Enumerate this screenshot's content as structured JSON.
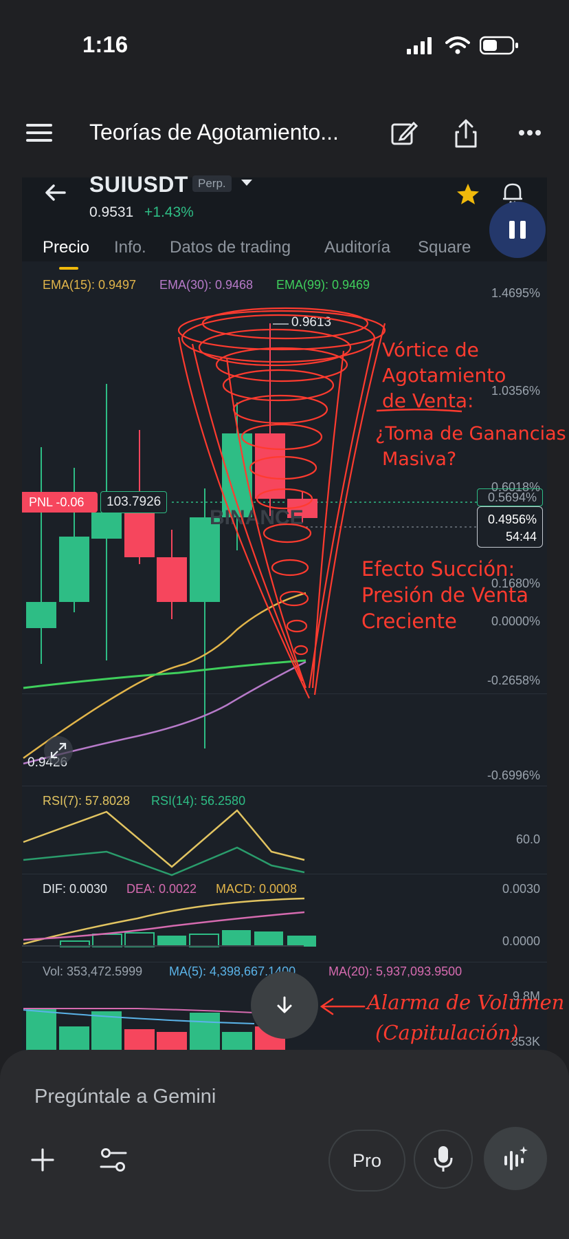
{
  "status_bar": {
    "time": "1:16"
  },
  "app_bar": {
    "title": "Teorías de Agotamiento..."
  },
  "ticker": {
    "pair": "SUIUSDT",
    "badge": "Perp.",
    "price": "0.9531",
    "change": "+1.43%"
  },
  "tabs": [
    "Precio",
    "Info.",
    "Datos de trading",
    "Auditoría",
    "Square"
  ],
  "indicators": {
    "ema15": "EMA(15): 0.9497",
    "ema30": "EMA(30): 0.9468",
    "ema99": "EMA(99): 0.9469",
    "rsi7": "RSI(7): 57.8028",
    "rsi14": "RSI(14): 56.2580",
    "dif": "DIF: 0.0030",
    "dea": "DEA: 0.0022",
    "macd": "MACD: 0.0008",
    "vol": "Vol: 353,472.5999",
    "vol_ma5": "MA(5): 4,398,667.1400",
    "vol_ma20": "MA(20): 5,937,093.9500"
  },
  "axis_labels": {
    "main": [
      "1.4695%",
      "1.0356%",
      "0.6018%",
      "0.5694%",
      "0.1680%",
      "0.0000%",
      "-0.2658%",
      "-0.6996%"
    ],
    "rsi": "60.0",
    "macd_top": "0.0030",
    "macd_zero": "0.0000",
    "vol_top": "9.8M",
    "vol_low": "353K"
  },
  "chart": {
    "high_label": "0.9613",
    "low_label": "0.9426",
    "pnl_label": "PNL -0.06",
    "pnl_value": "103.7926",
    "current_pct": "0.4956%",
    "countdown": "54:44",
    "watermark": "BINANCE"
  },
  "annotations": {
    "vortex": [
      "Vórtice de",
      "Agotamiento",
      "de Venta:",
      "¿Toma de Ganancias",
      "Masiva?"
    ],
    "suction": [
      "Efecto Succión:",
      "Presión de Venta",
      "Creciente"
    ],
    "volume": [
      "Alarma de Volumen",
      "(Capitulación)"
    ]
  },
  "composer": {
    "placeholder": "Pregúntale a Gemini",
    "mode_label": "Pro"
  },
  "colors": {
    "up": "#2ebd85",
    "down": "#f6465d",
    "ema15": "#e2b54a",
    "ema30": "#b77ac9",
    "ema99": "#3fcf5c",
    "annotation": "#ff3b2f"
  },
  "icons": [
    "menu-icon",
    "edit-icon",
    "share-icon",
    "more-icon",
    "back-arrow-icon",
    "star-icon",
    "bell-icon",
    "pause-icon",
    "expand-icon",
    "scroll-down-icon",
    "plus-icon",
    "tools-icon",
    "mic-icon",
    "live-icon"
  ]
}
